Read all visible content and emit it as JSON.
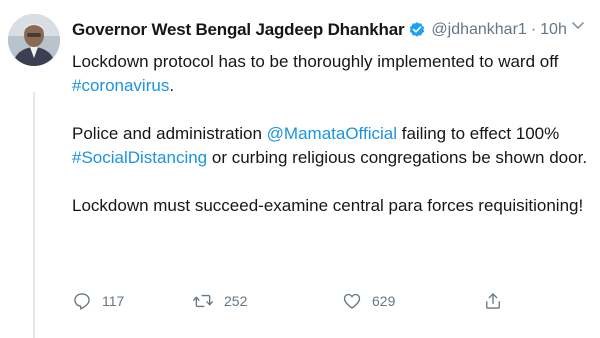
{
  "author": {
    "display_name": "Governor West Bengal Jagdeep Dhankhar",
    "handle": "@jdhankhar1",
    "separator": "·",
    "time": "10h",
    "verified": true
  },
  "tweet": {
    "line1_text": "Lockdown protocol has to be thoroughly implemented to ward off",
    "line1_hashtag": "#coronavirus",
    "line1_end": ".",
    "p2_start": "Police and administration ",
    "p2_mention": "@MamataOfficial",
    "p2_middle": " failing to effect 100%",
    "p2_hashtag": "#SocialDistancing",
    "p2_end": " or curbing religious congregations be shown door.",
    "p3": "Lockdown must succeed-examine central  para forces requisitioning!"
  },
  "actions": {
    "reply_count": "117",
    "retweet_count": "252",
    "like_count": "629"
  },
  "colors": {
    "link": "#1b95e0",
    "secondary_text": "#657786",
    "verified": "#1da1f2"
  },
  "icons": [
    "verified-badge-icon",
    "chevron-down-icon",
    "reply-icon",
    "retweet-icon",
    "like-icon",
    "share-icon"
  ]
}
